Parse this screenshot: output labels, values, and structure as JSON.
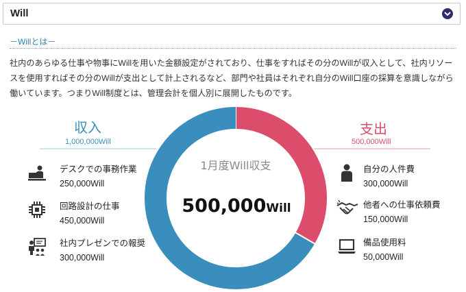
{
  "header": {
    "title": "Will"
  },
  "section": {
    "label": "－Willとは－"
  },
  "description": "社内のあらゆる仕事や物事にWillを用いた金額設定がされており、仕事をすればその分のWillが収入として、社内リソースを使用すればその分のWillが支出として計上されるなど、部門や社員はそれぞれ自分のWill口座の採算を意識しながら働いています。つまりWill制度とは、管理会計を個人別に展開したものです。",
  "income": {
    "title": "収入",
    "total": "1,000,000Will",
    "items": [
      {
        "icon": "desk-work-icon",
        "label": "デスクでの事務作業",
        "value": "250,000Will"
      },
      {
        "icon": "circuit-chip-icon",
        "label": "回路設計の仕事",
        "value": "450,000Will"
      },
      {
        "icon": "presentation-icon",
        "label": "社内プレゼンでの報奨",
        "value": "300,000Will"
      }
    ]
  },
  "expense": {
    "title": "支出",
    "total": "500,000Will",
    "items": [
      {
        "icon": "person-icon",
        "label": "自分の人件費",
        "value": "300,000Will"
      },
      {
        "icon": "handshake-icon",
        "label": "他者への仕事依頼費",
        "value": "150,000Will"
      },
      {
        "icon": "laptop-icon",
        "label": "備品使用料",
        "value": "50,000Will"
      }
    ]
  },
  "center": {
    "label": "1月度Will収支",
    "value": "500,000",
    "unit": "Will"
  },
  "chart_data": {
    "type": "pie",
    "categories": [
      "収入",
      "支出"
    ],
    "values": [
      1000000,
      500000
    ],
    "colors": [
      "#3a8ebd",
      "#dc4d6c"
    ]
  },
  "colors": {
    "income": "#3a8ebd",
    "expense": "#dc4d6c",
    "link": "#2f7fb0"
  }
}
